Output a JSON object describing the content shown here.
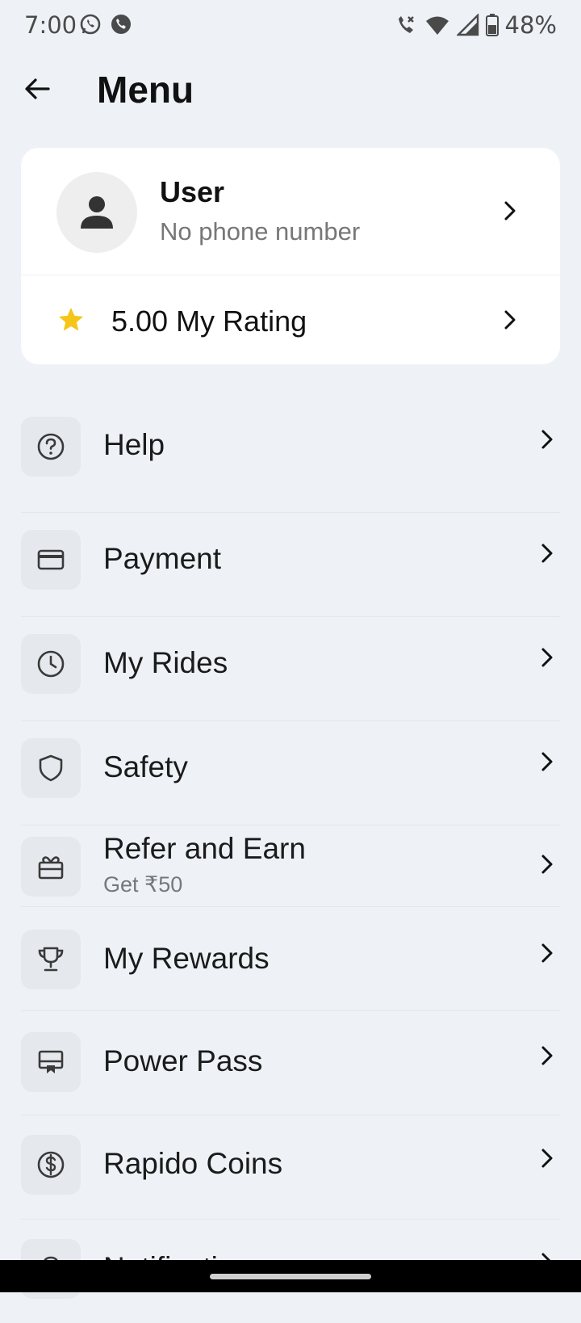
{
  "status_bar": {
    "time": "7:00",
    "battery": "48%"
  },
  "header": {
    "title": "Menu"
  },
  "profile": {
    "name": "User",
    "phone": "No phone number",
    "rating": "5.00 My Rating"
  },
  "menu": {
    "items": [
      {
        "label": "Help",
        "icon": "help-circle-icon"
      },
      {
        "label": "Payment",
        "icon": "credit-card-icon"
      },
      {
        "label": "My Rides",
        "icon": "clock-icon"
      },
      {
        "label": "Safety",
        "icon": "shield-icon"
      },
      {
        "label": "Refer and Earn",
        "sub": "Get ₹50",
        "icon": "gift-icon"
      },
      {
        "label": "My Rewards",
        "icon": "trophy-icon"
      },
      {
        "label": "Power Pass",
        "icon": "pass-icon"
      },
      {
        "label": "Rapido Coins",
        "icon": "coin-icon"
      },
      {
        "label": "Notifications",
        "icon": "bell-icon"
      }
    ]
  },
  "colors": {
    "background": "#eef2f7",
    "star": "#f5c518",
    "icon_box": "#e5e8ed"
  }
}
